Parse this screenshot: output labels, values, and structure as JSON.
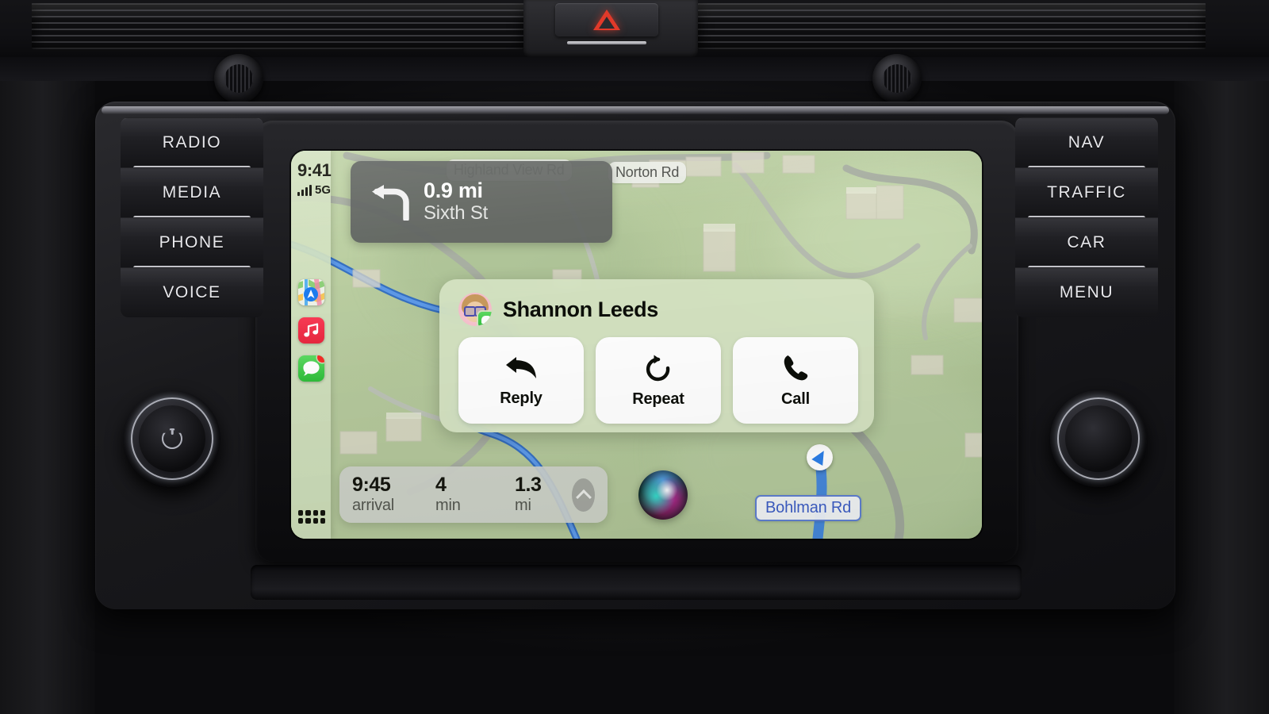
{
  "car": {
    "hazard_icon": "hazard-triangle-icon",
    "left_buttons": [
      {
        "label": "RADIO",
        "name": "radio"
      },
      {
        "label": "MEDIA",
        "name": "media"
      },
      {
        "label": "PHONE",
        "name": "phone"
      },
      {
        "label": "VOICE",
        "name": "voice"
      }
    ],
    "right_buttons": [
      {
        "label": "NAV",
        "name": "nav"
      },
      {
        "label": "TRAFFIC",
        "name": "traffic"
      },
      {
        "label": "CAR",
        "name": "car"
      },
      {
        "label": "MENU",
        "name": "menu"
      }
    ],
    "left_knob_icon": "power-icon",
    "right_knob_icon": "tune-knob-icon"
  },
  "screen": {
    "status_bar": {
      "time": "9:41",
      "signal_icon": "cellular-bars-icon",
      "network": "5G"
    },
    "sidebar": {
      "apps": [
        {
          "name": "maps",
          "label": "Maps",
          "icon": "maps-icon",
          "badge": false
        },
        {
          "name": "music",
          "label": "Music",
          "icon": "music-note-icon",
          "badge": false
        },
        {
          "name": "messages",
          "label": "Messages",
          "icon": "message-bubble-icon",
          "badge": true
        }
      ],
      "grid_button": "app-grid-icon"
    },
    "maneuver": {
      "icon": "turn-left-arrow-icon",
      "distance": "0.9 mi",
      "street": "Sixth St"
    },
    "map": {
      "labels": [
        {
          "name": "obscured-road-label",
          "text": "Highland View Rd"
        },
        {
          "name": "norton-rd-label",
          "text": "Norton Rd"
        }
      ],
      "shield": {
        "text": "Bohlman Rd",
        "border_color": "#5f7fd0",
        "text_color": "#3d5ec4"
      },
      "location_puck": "location-arrow-icon",
      "colors": {
        "terrain": "#b5c99c",
        "road": "#aab0a4",
        "river": "#3b78d8",
        "building": "#ded9cb"
      }
    },
    "notification": {
      "avatar": "memoji-avatar",
      "app_badge": "messages-badge-icon",
      "sender": "Shannon Leeds",
      "actions": [
        {
          "name": "reply",
          "label": "Reply",
          "icon": "reply-arrow-icon"
        },
        {
          "name": "repeat",
          "label": "Repeat",
          "icon": "repeat-arrow-icon"
        },
        {
          "name": "call",
          "label": "Call",
          "icon": "phone-handset-icon"
        }
      ]
    },
    "nav_bar": {
      "arrival_value": "9:45",
      "arrival_label": "arrival",
      "duration_value": "4",
      "duration_label": "min",
      "distance_value": "1.3",
      "distance_label": "mi",
      "expand_icon": "chevron-up-icon"
    },
    "siri": {
      "icon": "siri-orb",
      "label": "Siri"
    }
  }
}
